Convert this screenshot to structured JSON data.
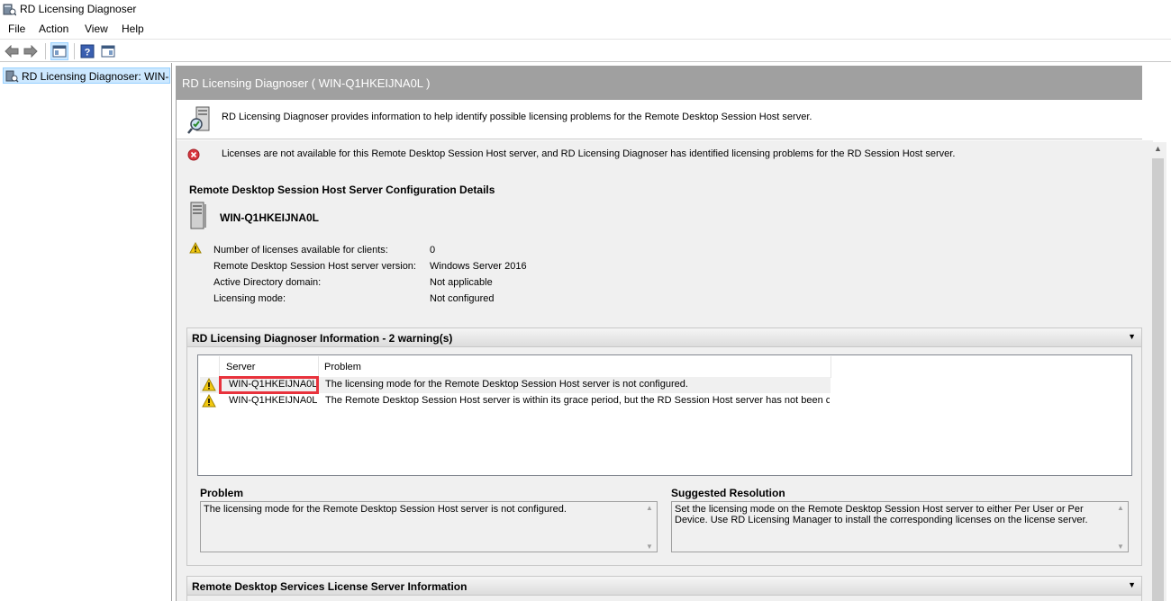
{
  "window": {
    "title": "RD Licensing Diagnoser"
  },
  "menu": [
    "File",
    "Action",
    "View",
    "Help"
  ],
  "toolbar": {
    "buttons": [
      "back-icon",
      "forward-icon",
      "show-hide-console-tree-icon",
      "help-icon",
      "action-pane-icon"
    ]
  },
  "tree": {
    "root_label": "RD Licensing Diagnoser: WIN-Q1HKEIJNA0L"
  },
  "main": {
    "header": "RD Licensing Diagnoser ( WIN-Q1HKEIJNA0L )",
    "description": "RD Licensing Diagnoser provides information to help identify possible licensing problems for the Remote Desktop Session Host server.",
    "error_message": "Licenses are not available for this Remote Desktop Session Host server, and RD Licensing Diagnoser has identified licensing problems for the RD Session Host server.",
    "config_section_title": "Remote Desktop Session Host Server Configuration Details",
    "server_name": "WIN-Q1HKEIJNA0L",
    "details": [
      {
        "label": "Number of licenses available for clients:",
        "value": "0"
      },
      {
        "label": "Remote Desktop Session Host server version:",
        "value": "Windows Server 2016"
      },
      {
        "label": "Active Directory domain:",
        "value": "Not applicable"
      },
      {
        "label": "Licensing mode:",
        "value": "Not configured"
      }
    ],
    "diag_group": {
      "title": "RD Licensing Diagnoser Information - 2 warning(s)",
      "columns": [
        "Server",
        "Problem"
      ],
      "rows": [
        {
          "server": "WIN-Q1HKEIJNA0L",
          "problem": "The licensing mode for the Remote Desktop Session Host server is not configured."
        },
        {
          "server": "WIN-Q1HKEIJNA0L",
          "problem": "The Remote Desktop Session Host server is within its grace period, but the RD Session Host server has not been c..."
        }
      ],
      "problem_label": "Problem",
      "problem_text": "The licensing mode for the Remote Desktop Session Host server is not configured.",
      "resolution_label": "Suggested Resolution",
      "resolution_text": "Set the licensing mode on the Remote Desktop Session Host server to either Per User or Per Device. Use RD Licensing Manager to install the corresponding licenses on the license server."
    },
    "license_group": {
      "title": "Remote Desktop Services License Server Information"
    }
  },
  "colors": {
    "header_bg": "#a0a0a0",
    "selection": "#cce8ff",
    "highlight_box": "#e8323c",
    "error": "#d9363e",
    "warning": "#f2c80f"
  }
}
